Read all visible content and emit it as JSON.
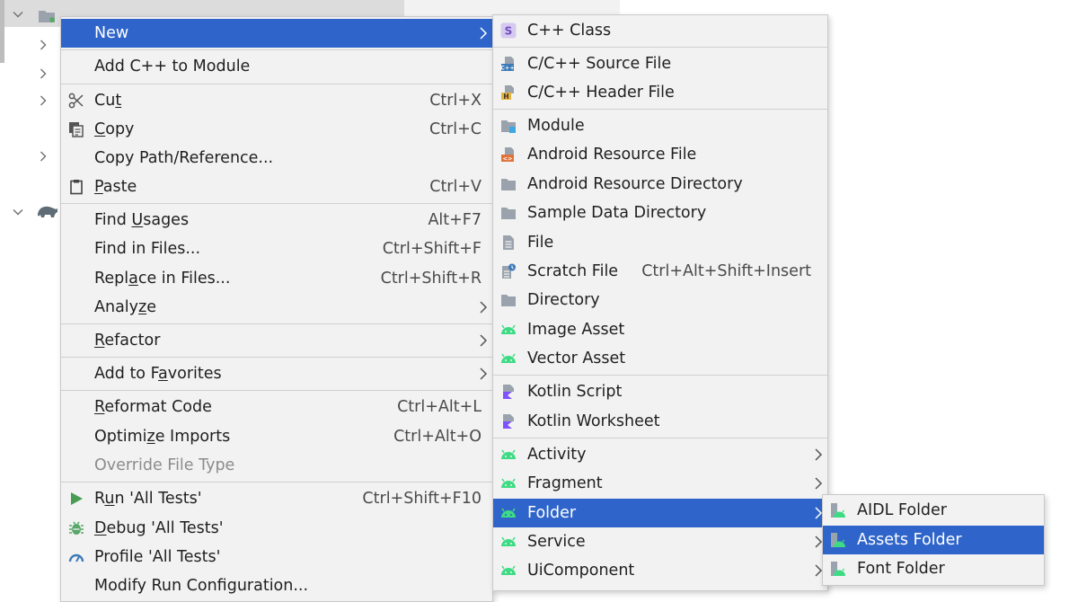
{
  "colors": {
    "selection": "#2f65ca",
    "menu_bg": "#f2f2f2",
    "android_green": "#3ddc84",
    "kotlin_purple": "#7f52ff"
  },
  "main_menu": {
    "items": [
      {
        "label": "New",
        "icon": null,
        "submenu": true,
        "selected": true
      },
      {
        "label": "Add C++ to Module",
        "icon": null
      },
      {
        "label_pre": "Cu",
        "label_u": "t",
        "label_post": "",
        "shortcut": "Ctrl+X",
        "icon": "scissors-icon"
      },
      {
        "label_pre": "",
        "label_u": "C",
        "label_post": "opy",
        "shortcut": "Ctrl+C",
        "icon": "copy-icon"
      },
      {
        "label": "Copy Path/Reference...",
        "icon": null
      },
      {
        "label_pre": "",
        "label_u": "P",
        "label_post": "aste",
        "shortcut": "Ctrl+V",
        "icon": "clipboard-icon"
      },
      {
        "label_pre": "Find ",
        "label_u": "U",
        "label_post": "sages",
        "shortcut": "Alt+F7"
      },
      {
        "label": "Find in Files...",
        "shortcut": "Ctrl+Shift+F"
      },
      {
        "label_pre": "Repl",
        "label_u": "a",
        "label_post": "ce in Files...",
        "shortcut": "Ctrl+Shift+R"
      },
      {
        "label_pre": "Analy",
        "label_u": "z",
        "label_post": "e",
        "submenu": true
      },
      {
        "label_pre": "",
        "label_u": "R",
        "label_post": "efactor",
        "submenu": true
      },
      {
        "label_pre": "Add to F",
        "label_u": "a",
        "label_post": "vorites",
        "submenu": true
      },
      {
        "label_pre": "",
        "label_u": "R",
        "label_post": "eformat Code",
        "shortcut": "Ctrl+Alt+L"
      },
      {
        "label_pre": "Optimi",
        "label_u": "z",
        "label_post": "e Imports",
        "shortcut": "Ctrl+Alt+O"
      },
      {
        "label": "Override File Type",
        "disabled": true
      },
      {
        "label_pre": "R",
        "label_u": "u",
        "label_post": "n 'All Tests'",
        "shortcut": "Ctrl+Shift+F10",
        "icon": "run-icon"
      },
      {
        "label_pre": "",
        "label_u": "D",
        "label_post": "ebug 'All Tests'",
        "icon": "debug-icon"
      },
      {
        "label": "Profile 'All Tests'",
        "icon": "profile-icon"
      },
      {
        "label": "Modify Run Configuration..."
      }
    ]
  },
  "new_menu": {
    "items": [
      {
        "label": "C++ Class",
        "icon": "cpp-class-icon"
      },
      {
        "label": "C/C++ Source File",
        "icon": "cpp-source-file-icon"
      },
      {
        "label": "C/C++ Header File",
        "icon": "cpp-header-file-icon"
      },
      {
        "label": "Module",
        "icon": "module-icon"
      },
      {
        "label": "Android Resource File",
        "icon": "resource-file-icon"
      },
      {
        "label": "Android Resource Directory",
        "icon": "folder-icon"
      },
      {
        "label": "Sample Data Directory",
        "icon": "folder-icon"
      },
      {
        "label": "File",
        "icon": "file-icon"
      },
      {
        "label": "Scratch File",
        "shortcut": "Ctrl+Alt+Shift+Insert",
        "icon": "scratch-file-icon"
      },
      {
        "label": "Directory",
        "icon": "folder-icon"
      },
      {
        "label": "Image Asset",
        "icon": "android-icon"
      },
      {
        "label": "Vector Asset",
        "icon": "android-icon"
      },
      {
        "label": "Kotlin Script",
        "icon": "kotlin-script-icon"
      },
      {
        "label": "Kotlin Worksheet",
        "icon": "kotlin-worksheet-icon"
      },
      {
        "label": "Activity",
        "icon": "android-icon",
        "submenu": true
      },
      {
        "label": "Fragment",
        "icon": "android-icon",
        "submenu": true
      },
      {
        "label": "Folder",
        "icon": "android-icon",
        "submenu": true,
        "selected": true
      },
      {
        "label": "Service",
        "icon": "android-icon",
        "submenu": true
      },
      {
        "label": "UiComponent",
        "icon": "android-icon",
        "submenu": true
      }
    ]
  },
  "folder_menu": {
    "items": [
      {
        "label": "AIDL Folder",
        "icon": "android-folder-icon"
      },
      {
        "label": "Assets Folder",
        "icon": "android-folder-icon",
        "selected": true
      },
      {
        "label": "Font Folder",
        "icon": "android-folder-icon"
      }
    ]
  }
}
